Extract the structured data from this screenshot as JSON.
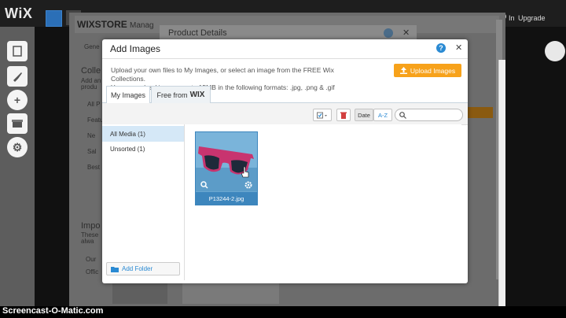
{
  "topbar": {
    "logo": "WiX",
    "upgrade": "Upgrade",
    "partial_link": "In"
  },
  "background": {
    "store_title": "WIXSTORE",
    "store_sub": "Manag",
    "product_details_title": "Product Details",
    "labels": [
      "Colle",
      "Impo"
    ],
    "fragments": [
      "Gene",
      "Add an",
      "produ",
      "All P",
      "Featu",
      "Ne",
      "Sal",
      "Best",
      "These",
      "alwa",
      "Our",
      "Offic"
    ]
  },
  "dialog": {
    "title": "Add Images",
    "help_glyph": "?",
    "close_glyph": "✕",
    "description_line1": "Upload your own files to My Images, or select an image from the FREE Wix Collections.",
    "description_line2": "You can upload images up to 15MB in the following formats: .jpg, .png & .gif",
    "upload_label": "Upload Images",
    "tabs": [
      {
        "label": "My Images",
        "active": true
      },
      {
        "label": "Free from",
        "brand": "WIX",
        "active": false
      }
    ],
    "toolbar": {
      "sort_date": "Date",
      "sort_az": "A-Z",
      "search_placeholder": ""
    },
    "sidebar": {
      "items": [
        {
          "label": "All Media (1)",
          "selected": true
        },
        {
          "label": "Unsorted (1)",
          "selected": false
        }
      ],
      "add_folder": "Add Folder"
    },
    "images": [
      {
        "filename": "P13244-2.jpg"
      }
    ]
  },
  "watermark": "Screencast-O-Matic.com",
  "colors": {
    "accent": "#2a8ad3",
    "upload": "#f7a21b",
    "selected_row": "#d5e8f7"
  }
}
